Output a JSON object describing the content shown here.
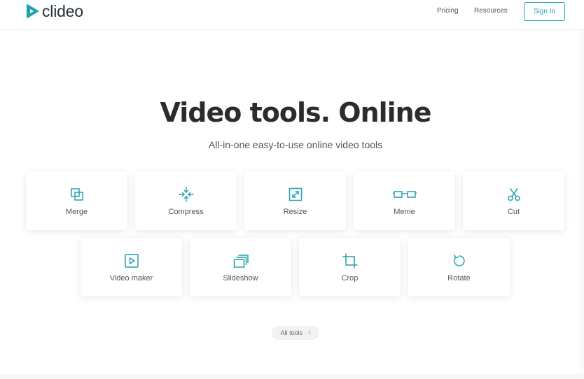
{
  "header": {
    "logo_text": "clideo",
    "nav": {
      "pricing": "Pricing",
      "resources": "Resources"
    },
    "signin_label": "Sign In",
    "accent_color": "#20a2b0"
  },
  "hero": {
    "title": "Video tools. Online",
    "subtitle": "All-in-one easy-to-use online video tools"
  },
  "tools": [
    {
      "label": "Merge",
      "icon": "merge-icon"
    },
    {
      "label": "Compress",
      "icon": "compress-icon"
    },
    {
      "label": "Resize",
      "icon": "resize-icon"
    },
    {
      "label": "Meme",
      "icon": "meme-icon"
    },
    {
      "label": "Cut",
      "icon": "scissors-icon"
    },
    {
      "label": "Video maker",
      "icon": "video-maker-icon"
    },
    {
      "label": "Slideshow",
      "icon": "slideshow-icon"
    },
    {
      "label": "Crop",
      "icon": "crop-icon"
    },
    {
      "label": "Rotate",
      "icon": "rotate-icon"
    }
  ],
  "all_tools_label": "All tools"
}
